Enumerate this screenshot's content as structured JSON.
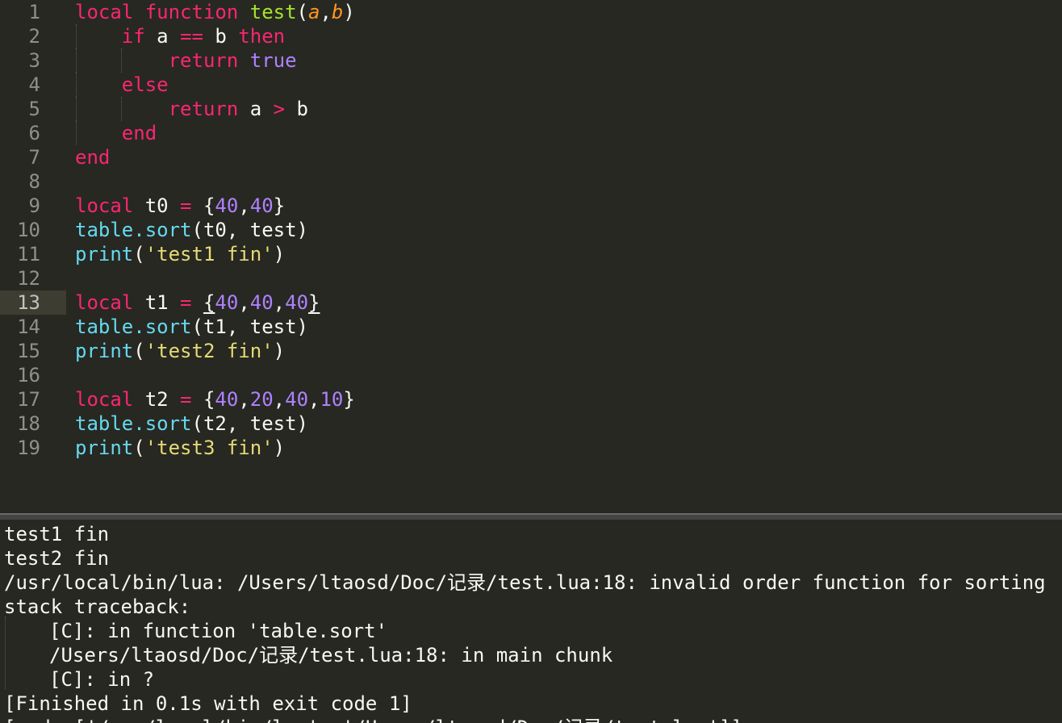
{
  "editor": {
    "current_line": "13",
    "lines": [
      {
        "num": "1",
        "tokens": [
          {
            "t": "local",
            "c": "kw"
          },
          {
            "t": " ",
            "c": "plain"
          },
          {
            "t": "function",
            "c": "kw"
          },
          {
            "t": " ",
            "c": "plain"
          },
          {
            "t": "test",
            "c": "fn"
          },
          {
            "t": "(",
            "c": "plain"
          },
          {
            "t": "a",
            "c": "param"
          },
          {
            "t": ",",
            "c": "plain"
          },
          {
            "t": "b",
            "c": "param"
          },
          {
            "t": ")",
            "c": "plain"
          }
        ]
      },
      {
        "num": "2",
        "tokens": [
          {
            "t": "    ",
            "c": "plain"
          },
          {
            "t": "if",
            "c": "kw"
          },
          {
            "t": " a ",
            "c": "plain"
          },
          {
            "t": "==",
            "c": "kw"
          },
          {
            "t": " b ",
            "c": "plain"
          },
          {
            "t": "then",
            "c": "kw"
          }
        ]
      },
      {
        "num": "3",
        "tokens": [
          {
            "t": "        ",
            "c": "plain"
          },
          {
            "t": "return",
            "c": "kw"
          },
          {
            "t": " ",
            "c": "plain"
          },
          {
            "t": "true",
            "c": "const"
          }
        ]
      },
      {
        "num": "4",
        "tokens": [
          {
            "t": "    ",
            "c": "plain"
          },
          {
            "t": "else",
            "c": "kw"
          }
        ]
      },
      {
        "num": "5",
        "tokens": [
          {
            "t": "        ",
            "c": "plain"
          },
          {
            "t": "return",
            "c": "kw"
          },
          {
            "t": " a ",
            "c": "plain"
          },
          {
            "t": ">",
            "c": "kw"
          },
          {
            "t": " b",
            "c": "plain"
          }
        ]
      },
      {
        "num": "6",
        "tokens": [
          {
            "t": "    ",
            "c": "plain"
          },
          {
            "t": "end",
            "c": "kw"
          }
        ]
      },
      {
        "num": "7",
        "tokens": [
          {
            "t": "end",
            "c": "kw"
          }
        ]
      },
      {
        "num": "8",
        "tokens": []
      },
      {
        "num": "9",
        "tokens": [
          {
            "t": "local",
            "c": "kw"
          },
          {
            "t": " t0 ",
            "c": "plain"
          },
          {
            "t": "=",
            "c": "kw"
          },
          {
            "t": " {",
            "c": "plain"
          },
          {
            "t": "40",
            "c": "num"
          },
          {
            "t": ",",
            "c": "plain"
          },
          {
            "t": "40",
            "c": "num"
          },
          {
            "t": "}",
            "c": "plain"
          }
        ]
      },
      {
        "num": "10",
        "tokens": [
          {
            "t": "table.sort",
            "c": "sup"
          },
          {
            "t": "(t0, test)",
            "c": "plain"
          }
        ]
      },
      {
        "num": "11",
        "tokens": [
          {
            "t": "print",
            "c": "sup"
          },
          {
            "t": "(",
            "c": "plain"
          },
          {
            "t": "'test1 fin'",
            "c": "str"
          },
          {
            "t": ")",
            "c": "plain"
          }
        ]
      },
      {
        "num": "12",
        "tokens": []
      },
      {
        "num": "13",
        "tokens": [
          {
            "t": "local",
            "c": "kw"
          },
          {
            "t": " t1 ",
            "c": "plain"
          },
          {
            "t": "=",
            "c": "kw"
          },
          {
            "t": " ",
            "c": "plain"
          },
          {
            "t": "{",
            "c": "plain brace-hl"
          },
          {
            "t": "40",
            "c": "num"
          },
          {
            "t": ",",
            "c": "plain"
          },
          {
            "t": "40",
            "c": "num"
          },
          {
            "t": ",",
            "c": "plain"
          },
          {
            "t": "40",
            "c": "num"
          },
          {
            "t": "}",
            "c": "plain brace-hl"
          }
        ]
      },
      {
        "num": "14",
        "tokens": [
          {
            "t": "table.sort",
            "c": "sup"
          },
          {
            "t": "(t1, test)",
            "c": "plain"
          }
        ]
      },
      {
        "num": "15",
        "tokens": [
          {
            "t": "print",
            "c": "sup"
          },
          {
            "t": "(",
            "c": "plain"
          },
          {
            "t": "'test2 fin'",
            "c": "str"
          },
          {
            "t": ")",
            "c": "plain"
          }
        ]
      },
      {
        "num": "16",
        "tokens": []
      },
      {
        "num": "17",
        "tokens": [
          {
            "t": "local",
            "c": "kw"
          },
          {
            "t": " t2 ",
            "c": "plain"
          },
          {
            "t": "=",
            "c": "kw"
          },
          {
            "t": " {",
            "c": "plain"
          },
          {
            "t": "40",
            "c": "num"
          },
          {
            "t": ",",
            "c": "plain"
          },
          {
            "t": "20",
            "c": "num"
          },
          {
            "t": ",",
            "c": "plain"
          },
          {
            "t": "40",
            "c": "num"
          },
          {
            "t": ",",
            "c": "plain"
          },
          {
            "t": "10",
            "c": "num"
          },
          {
            "t": "}",
            "c": "plain"
          }
        ]
      },
      {
        "num": "18",
        "tokens": [
          {
            "t": "table.sort",
            "c": "sup"
          },
          {
            "t": "(t2, test)",
            "c": "plain"
          }
        ]
      },
      {
        "num": "19",
        "tokens": [
          {
            "t": "print",
            "c": "sup"
          },
          {
            "t": "(",
            "c": "plain"
          },
          {
            "t": "'test3 fin'",
            "c": "str"
          },
          {
            "t": ")",
            "c": "plain"
          }
        ]
      }
    ]
  },
  "console": {
    "lines": [
      {
        "text": "test1 fin",
        "indent": false
      },
      {
        "text": "test2 fin",
        "indent": false
      },
      {
        "text": "/usr/local/bin/lua: /Users/ltaosd/Doc/记录/test.lua:18: invalid order function for sorting",
        "indent": false
      },
      {
        "text": "stack traceback:",
        "indent": false
      },
      {
        "text": "[C]: in function 'table.sort'",
        "indent": true
      },
      {
        "text": "/Users/ltaosd/Doc/记录/test.lua:18: in main chunk",
        "indent": true
      },
      {
        "text": "[C]: in ?",
        "indent": true
      },
      {
        "text": "[Finished in 0.1s with exit code 1]",
        "indent": false
      },
      {
        "text": "[cmd: ['/usr/local/bin/lua', '/Users/ltaosd/Doc/记录/test.lua']]",
        "indent": false
      }
    ]
  },
  "colors": {
    "background": "#272822",
    "keyword": "#f92672",
    "function_name": "#a6e22e",
    "parameter": "#fd971f",
    "number": "#ae81ff",
    "support": "#66d9ef",
    "string": "#e6db74",
    "text": "#f8f8f2",
    "gutter": "#8f908a"
  }
}
